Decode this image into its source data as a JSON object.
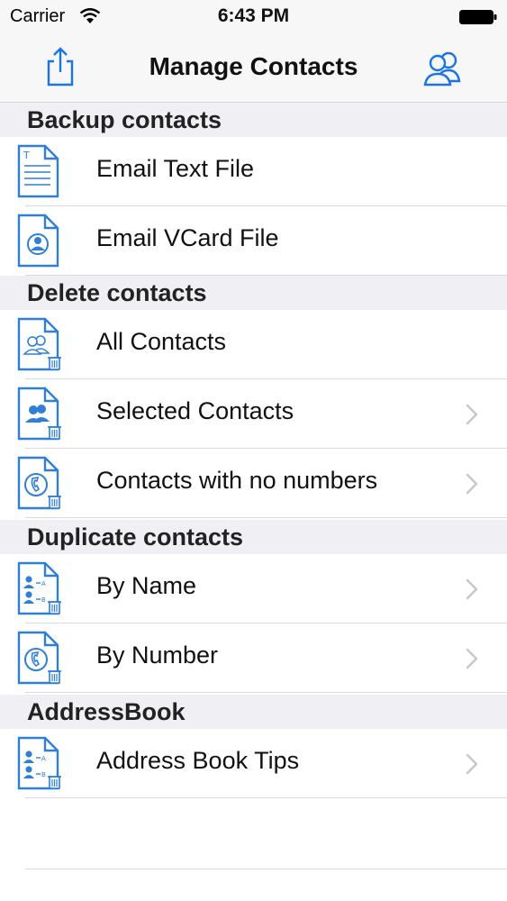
{
  "status_bar": {
    "carrier": "Carrier",
    "time": "6:43 PM"
  },
  "nav": {
    "title": "Manage Contacts",
    "left_icon": "share-icon",
    "right_icon": "contacts-icon",
    "accent_color": "#1a73e8"
  },
  "sections": [
    {
      "header": "Backup contacts",
      "items": [
        {
          "label": "Email Text File",
          "icon": "text-file-icon",
          "chevron": false
        },
        {
          "label": "Email VCard File",
          "icon": "vcard-file-icon",
          "chevron": false
        }
      ]
    },
    {
      "header": "Delete contacts",
      "items": [
        {
          "label": "All Contacts",
          "icon": "delete-all-contacts-icon",
          "chevron": false
        },
        {
          "label": "Selected Contacts",
          "icon": "delete-selected-contacts-icon",
          "chevron": true
        },
        {
          "label": "Contacts with no numbers",
          "icon": "delete-no-number-icon",
          "chevron": true
        }
      ]
    },
    {
      "header": "Duplicate contacts",
      "items": [
        {
          "label": "By Name",
          "icon": "duplicate-by-name-icon",
          "chevron": true
        },
        {
          "label": "By Number",
          "icon": "duplicate-by-number-icon",
          "chevron": true
        }
      ]
    },
    {
      "header": "AddressBook",
      "items": [
        {
          "label": "Address Book Tips",
          "icon": "address-book-tips-icon",
          "chevron": true
        }
      ]
    }
  ]
}
